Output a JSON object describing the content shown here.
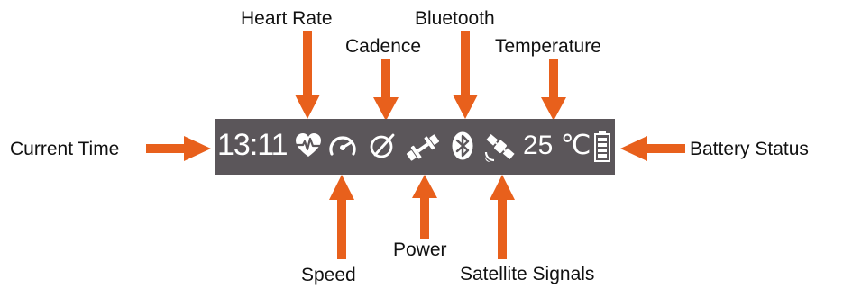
{
  "display": {
    "time": "13:11",
    "temperature": "25 ℃"
  },
  "icons": [
    "heart-rate-icon",
    "speed-icon",
    "cadence-icon",
    "power-icon",
    "bluetooth-icon",
    "satellite-icon",
    "battery-icon"
  ],
  "labels": {
    "heart_rate": "Heart Rate",
    "cadence": "Cadence",
    "bluetooth": "Bluetooth",
    "temperature": "Temperature",
    "current_time": "Current Time",
    "battery_status": "Battery Status",
    "speed": "Speed",
    "power": "Power",
    "satellite_signals": "Satellite Signals"
  },
  "colors": {
    "arrow": "#e8601c",
    "display_bg": "#5b565a",
    "display_fg": "#ffffff"
  }
}
